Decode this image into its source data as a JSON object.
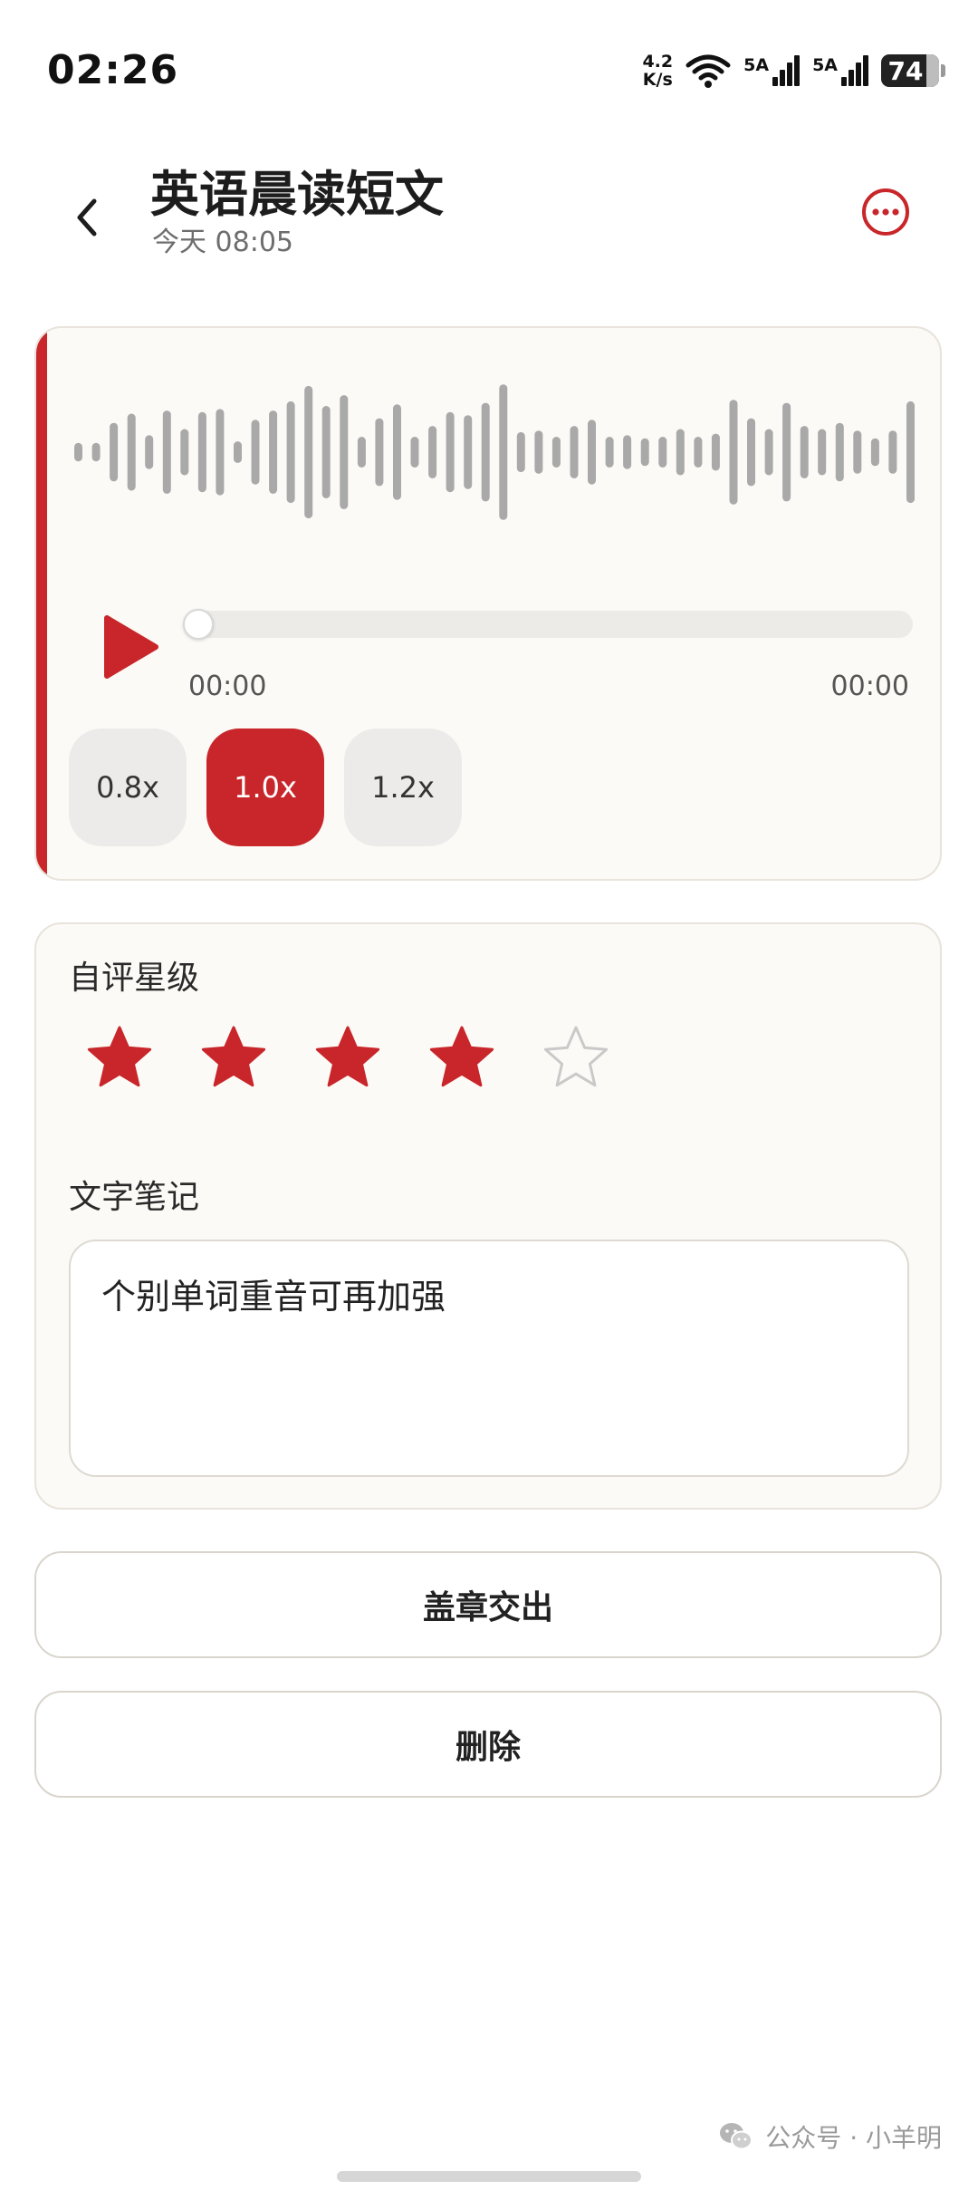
{
  "status_bar": {
    "time": "02:26",
    "net_speed_value": "4.2",
    "net_speed_unit": "K/s",
    "signal_1_label": "5A",
    "signal_2_label": "5A",
    "battery": "74"
  },
  "header": {
    "title": "英语晨读短文",
    "subtitle": "今天 08:05",
    "back_icon": "chevron-left-icon",
    "more_icon": "more-horizontal-circle-icon"
  },
  "player": {
    "current_time": "00:00",
    "total_time": "00:00",
    "progress_fraction": 0,
    "speed_options": [
      "0.8x",
      "1.0x",
      "1.2x"
    ],
    "selected_speed": "1.0x",
    "accent_color": "#c8262a",
    "waveform_levels": [
      0.12,
      0.12,
      0.38,
      0.5,
      0.22,
      0.54,
      0.3,
      0.52,
      0.56,
      0.14,
      0.42,
      0.54,
      0.66,
      0.86,
      0.6,
      0.74,
      0.2,
      0.44,
      0.62,
      0.2,
      0.34,
      0.52,
      0.48,
      0.64,
      0.88,
      0.26,
      0.28,
      0.2,
      0.34,
      0.42,
      0.2,
      0.22,
      0.18,
      0.2,
      0.3,
      0.2,
      0.24,
      0.68,
      0.44,
      0.3,
      0.64,
      0.34,
      0.3,
      0.38,
      0.28,
      0.18,
      0.28,
      0.66
    ]
  },
  "review": {
    "rating_label": "自评星级",
    "rating": 4,
    "rating_max": 5,
    "star_filled_color": "#c8262a",
    "star_empty_color": "#c9c9c9",
    "note_label": "文字笔记",
    "note_text": "个别单词重音可再加强"
  },
  "actions": {
    "stamp_submit": "盖章交出",
    "delete": "删除"
  },
  "watermark": "公众号 · 小羊明"
}
